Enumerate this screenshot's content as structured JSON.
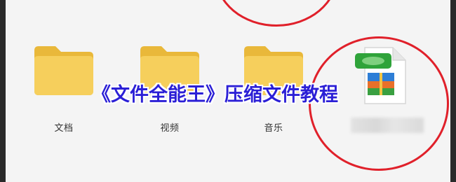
{
  "overlay": {
    "title": "《文件全能王》压缩文件教程"
  },
  "files": [
    {
      "name": "文档",
      "icon": "folder-icon"
    },
    {
      "name": "视频",
      "icon": "folder-icon"
    },
    {
      "name": "音乐",
      "icon": "folder-icon"
    }
  ],
  "archive": {
    "icon": "zip-file-icon"
  },
  "colors": {
    "folder": "#f2c443",
    "folder_light": "#f8d76a",
    "highlight": "#e0202a",
    "title": "#2b1fd6"
  }
}
